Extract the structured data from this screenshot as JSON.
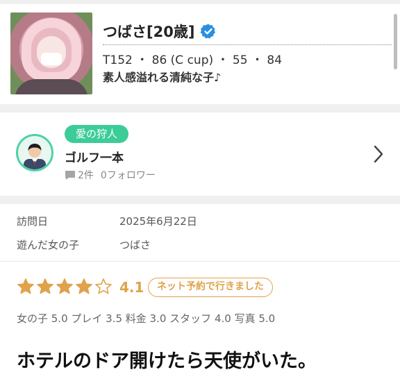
{
  "profile": {
    "name": "つばさ[20歳]",
    "stats": "T152 ・ 86 (C cup) ・ 55 ・ 84",
    "catchphrase": "素人感溢れる清純な子♪",
    "verified_color": "#2b8fe0"
  },
  "reviewer": {
    "badge": "愛の狩人",
    "name": "ゴルフ一本",
    "posts": "2件",
    "followers": "0フォロワー",
    "badge_color": "#3ccc98"
  },
  "detail": {
    "visit_label": "訪問日",
    "visit_value": "2025年6月22日",
    "girl_label": "遊んだ女の子",
    "girl_value": "つばさ",
    "rating": 4.1,
    "rating_text": "4.1",
    "stars_total": 5,
    "reservation_pill": "ネット予約で行きました",
    "subscores": "女の子 5.0 プレイ 3.5 料金 3.0 スタッフ 4.0 写真 5.0",
    "headline": "ホテルのドア開けたら天使がいた。",
    "accent_color": "#e0a24a"
  }
}
